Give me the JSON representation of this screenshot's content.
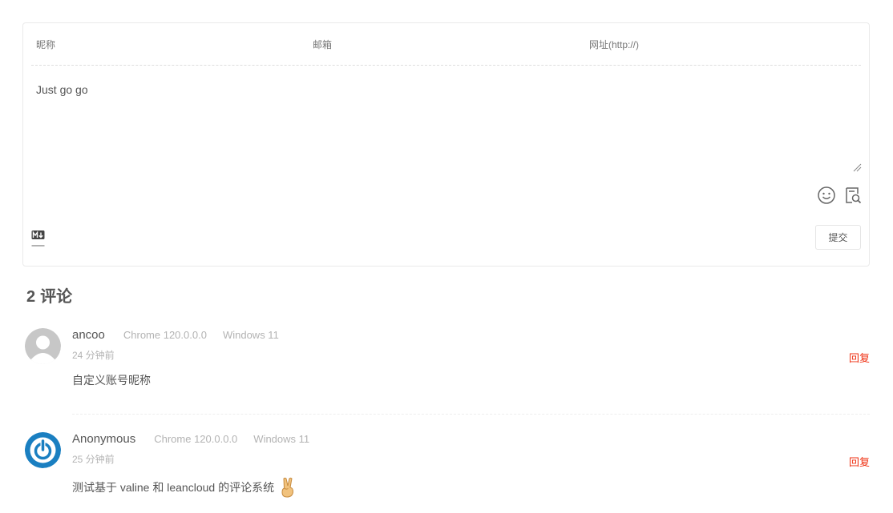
{
  "form": {
    "nick_placeholder": "昵称",
    "mail_placeholder": "邮箱",
    "link_placeholder": "网址(http://)",
    "content_value": "Just go go",
    "submit_label": "提交"
  },
  "comments_header": {
    "count": "2",
    "label": "评论"
  },
  "comments": [
    {
      "nick": "ancoo",
      "browser": "Chrome 120.0.0.0",
      "os": "Windows 11",
      "time": "24 分钟前",
      "text": "自定义账号昵称",
      "reply_label": "回复"
    },
    {
      "nick": "Anonymous",
      "browser": "Chrome 120.0.0.0",
      "os": "Windows 11",
      "time": "25 分钟前",
      "text": "测试基于 valine 和 leancloud 的评论系统",
      "reply_label": "回复"
    }
  ],
  "icons": {
    "emoji_button": "smiley-face-icon",
    "preview_button": "preview-icon",
    "markdown": "markdown-icon",
    "inline_emoji": "victory-hand-emoji"
  },
  "colors": {
    "reply": "#ef2f11",
    "meta": "#b3b3b3",
    "text": "#555555",
    "avatar_blue": "#1a7fc1"
  }
}
